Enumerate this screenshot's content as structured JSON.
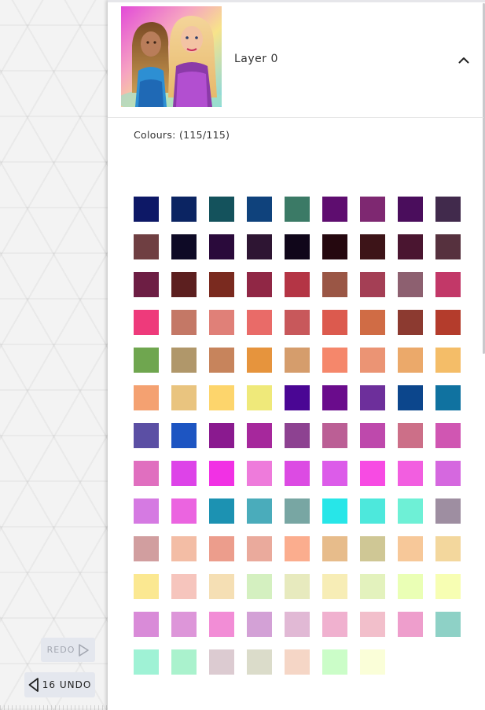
{
  "history": {
    "redo_label": "REDO",
    "undo_label": "16 UNDO"
  },
  "layer": {
    "name": "Layer 0"
  },
  "palette": {
    "colours_label": "Colours: (115/115)",
    "swatches": [
      "#0d1866",
      "#0b2462",
      "#14525c",
      "#0f427c",
      "#3b7a66",
      "#5e0d6f",
      "#7e2871",
      "#4a0d5c",
      "#412a4c",
      "#6f3f42",
      "#0e0a26",
      "#2a0a3b",
      "#2e1533",
      "#10061a",
      "#25080f",
      "#3d1418",
      "#4a1530",
      "#56313e",
      "#6d1e44",
      "#5c1f1f",
      "#7a2a1f",
      "#902745",
      "#b43545",
      "#9a5645",
      "#a43f55",
      "#8d6070",
      "#c23868",
      "#ee3a7b",
      "#c47866",
      "#e08078",
      "#e96b68",
      "#c8585b",
      "#dc5a4e",
      "#d06c45",
      "#8c3a30",
      "#b43c2c",
      "#6fa64f",
      "#b0976a",
      "#c7845c",
      "#e6943d",
      "#d59d6c",
      "#f5876b",
      "#eb9474",
      "#eba96a",
      "#f4bd68",
      "#f4a171",
      "#e9c47f",
      "#fdd56c",
      "#efe97a",
      "#4a0694",
      "#6a0c8c",
      "#6d2f9b",
      "#0c468c",
      "#1072a0",
      "#5b4fa4",
      "#1d55c2",
      "#8a1a8f",
      "#a6289c",
      "#8d4291",
      "#bb5f95",
      "#be49ac",
      "#cc6f88",
      "#d056b2",
      "#e06fbf",
      "#dd43e8",
      "#f131e4",
      "#ee7bdb",
      "#dc4be3",
      "#dc5ce9",
      "#f74be3",
      "#f25ee0",
      "#d568df",
      "#d57ae2",
      "#eb64e0",
      "#1c92b2",
      "#4aacbb",
      "#78a6a3",
      "#27e6e8",
      "#4de8dc",
      "#6ef0d6",
      "#9e8ea1",
      "#d19e9f",
      "#f3bda5",
      "#ec9d8c",
      "#eaaa9c",
      "#fbad8e",
      "#e7bc8b",
      "#cfc795",
      "#f7c899",
      "#f3d79d",
      "#fbe891",
      "#f6c5bd",
      "#f5dfb4",
      "#d4f0c0",
      "#e7eabe",
      "#f7edb6",
      "#e3f2bd",
      "#eaffb5",
      "#f7feb3",
      "#d98bd8",
      "#dd96d9",
      "#f28dd6",
      "#d3a1d6",
      "#e1b9d5",
      "#f0b1cf",
      "#f2bfcb",
      "#ee9ecc",
      "#8ed1c6",
      "#9ff2d5",
      "#aaf2cd",
      "#dccbd1",
      "#dbdcca",
      "#f5d6c6",
      "#cbfdc8",
      "#fafed8"
    ]
  }
}
